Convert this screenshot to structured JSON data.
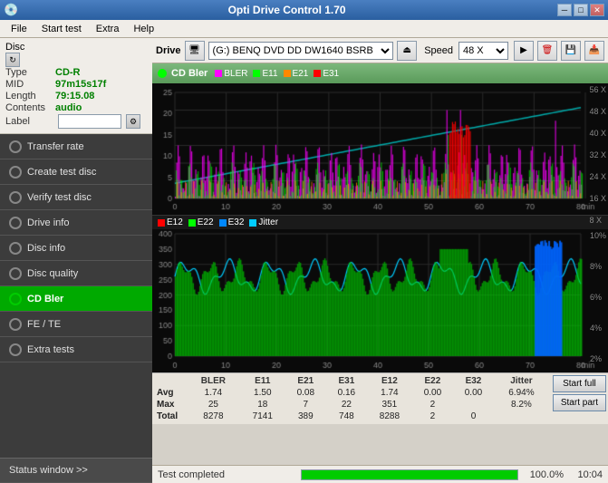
{
  "titlebar": {
    "title": "Opti Drive Control 1.70",
    "icon": "💿",
    "btn_minimize": "─",
    "btn_maximize": "□",
    "btn_close": "✕"
  },
  "menubar": {
    "items": [
      "File",
      "Start test",
      "Extra",
      "Help"
    ]
  },
  "drive": {
    "label": "Drive",
    "drive_value": "(G:)  BENQ DVD DD DW1640 BSRB",
    "speed_label": "Speed",
    "speed_value": "48 X"
  },
  "disc": {
    "header": "Disc",
    "type_label": "Type",
    "type_value": "CD-R",
    "mid_label": "MID",
    "mid_value": "97m15s17f",
    "length_label": "Length",
    "length_value": "79:15.08",
    "contents_label": "Contents",
    "contents_value": "audio",
    "label_label": "Label",
    "label_value": ""
  },
  "nav": {
    "items": [
      {
        "id": "transfer-rate",
        "label": "Transfer rate",
        "active": false
      },
      {
        "id": "create-test-disc",
        "label": "Create test disc",
        "active": false
      },
      {
        "id": "verify-test-disc",
        "label": "Verify test disc",
        "active": false
      },
      {
        "id": "drive-info",
        "label": "Drive info",
        "active": false
      },
      {
        "id": "disc-info",
        "label": "Disc info",
        "active": false
      },
      {
        "id": "disc-quality",
        "label": "Disc quality",
        "active": false
      },
      {
        "id": "cd-bler",
        "label": "CD Bler",
        "active": true
      },
      {
        "id": "fe-te",
        "label": "FE / TE",
        "active": false
      },
      {
        "id": "extra-tests",
        "label": "Extra tests",
        "active": false
      }
    ]
  },
  "chart_header": {
    "title": "CD Bler",
    "legend_top": [
      "BLER",
      "E11",
      "E21",
      "E31"
    ],
    "legend_top_colors": [
      "#ff00ff",
      "#00ff00",
      "#ff8800",
      "#ff0000"
    ],
    "legend_bottom": [
      "E12",
      "E22",
      "E32",
      "Jitter"
    ],
    "legend_bottom_colors": [
      "#ff0000",
      "#00ff00",
      "#0088ff",
      "#00ccff"
    ]
  },
  "stats": {
    "columns": [
      "",
      "BLER",
      "E11",
      "E21",
      "E31",
      "E12",
      "E22",
      "E32",
      "Jitter"
    ],
    "rows": [
      {
        "label": "Avg",
        "values": [
          "1.74",
          "1.50",
          "0.08",
          "0.16",
          "1.74",
          "0.00",
          "0.00",
          "6.94%"
        ]
      },
      {
        "label": "Max",
        "values": [
          "25",
          "18",
          "7",
          "22",
          "351",
          "2",
          "",
          "8.2%"
        ]
      },
      {
        "label": "Total",
        "values": [
          "8278",
          "7141",
          "389",
          "748",
          "8288",
          "2",
          "0",
          ""
        ]
      }
    ],
    "btn_start_full": "Start full",
    "btn_start_part": "Start part"
  },
  "statusbar": {
    "status_text": "Test completed",
    "progress_pct": "100.0%",
    "progress_value": 100,
    "time": "10:04",
    "status_window_label": "Status window >>"
  }
}
